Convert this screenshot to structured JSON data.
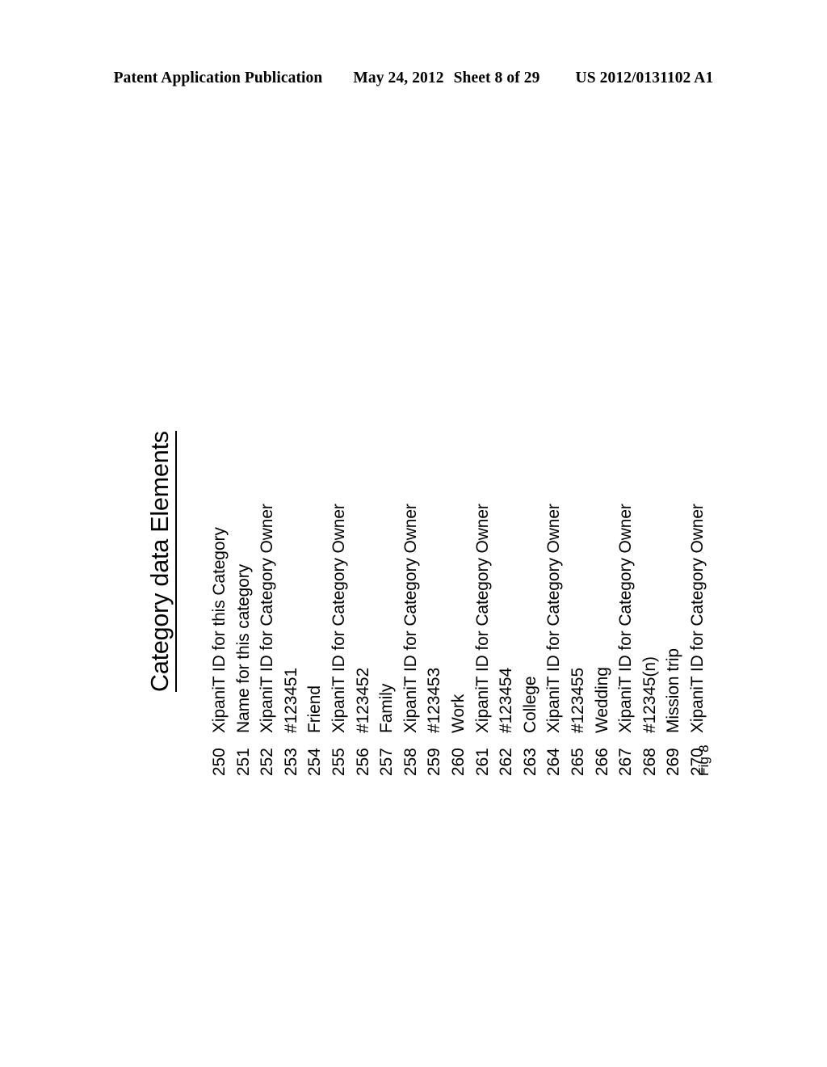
{
  "header": {
    "publication": "Patent Application Publication",
    "date": "May 24, 2012",
    "sheet": "Sheet 8 of 29",
    "patent_number": "US 2012/0131102 A1"
  },
  "figure": {
    "label": "Fig 8",
    "title": "Category data Elements",
    "elements": [
      {
        "number": "250",
        "description": "XipaniT ID for this Category"
      },
      {
        "number": "251",
        "description": "Name for this category"
      },
      {
        "number": "252",
        "description": "XipaniT ID for Category Owner"
      },
      {
        "number": "253",
        "description": "#123451"
      },
      {
        "number": "254",
        "description": "Friend"
      },
      {
        "number": "255",
        "description": "XipaniT ID for Category Owner"
      },
      {
        "number": "256",
        "description": "#123452"
      },
      {
        "number": "257",
        "description": "Family"
      },
      {
        "number": "258",
        "description": "XipaniT ID for Category Owner"
      },
      {
        "number": "259",
        "description": "#123453"
      },
      {
        "number": "260",
        "description": "Work"
      },
      {
        "number": "261",
        "description": "XipaniT ID for Category Owner"
      },
      {
        "number": "262",
        "description": "#123454"
      },
      {
        "number": "263",
        "description": "College"
      },
      {
        "number": "264",
        "description": "XipaniT ID for Category Owner"
      },
      {
        "number": "265",
        "description": "#123455"
      },
      {
        "number": "266",
        "description": "Wedding"
      },
      {
        "number": "267",
        "description": "XipaniT ID for Category Owner"
      },
      {
        "number": "268",
        "description": "#12345(n)"
      },
      {
        "number": "269",
        "description": "Mission trip"
      },
      {
        "number": "270",
        "description": "XipaniT ID for Category Owner"
      }
    ]
  }
}
